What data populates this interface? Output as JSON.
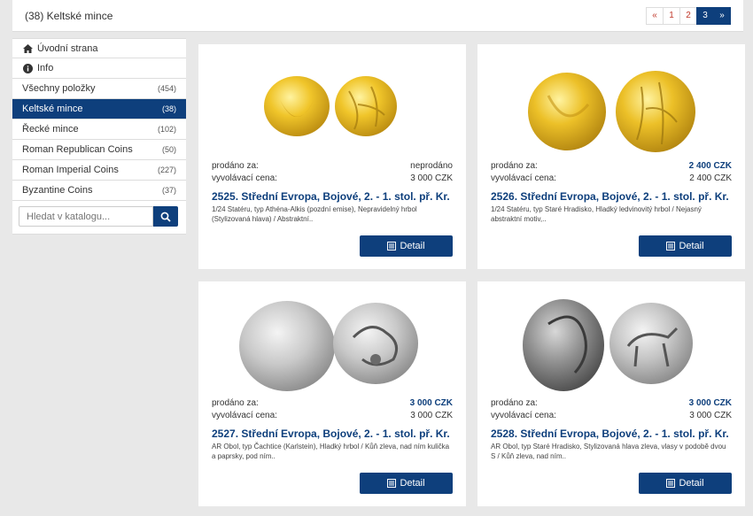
{
  "header": {
    "title": "(38) Keltské mince"
  },
  "pagination": {
    "prev": "«",
    "pages": [
      "1",
      "2",
      "3"
    ],
    "active": "3",
    "next": "»"
  },
  "sidebar": {
    "home": "Úvodní strana",
    "info": "Info",
    "items": [
      {
        "label": "Všechny položky",
        "count": "(454)"
      },
      {
        "label": "Keltské mince",
        "count": "(38)"
      },
      {
        "label": "Řecké mince",
        "count": "(102)"
      },
      {
        "label": "Roman Republican Coins",
        "count": "(50)"
      },
      {
        "label": "Roman Imperial Coins",
        "count": "(227)"
      },
      {
        "label": "Byzantine Coins",
        "count": "(37)"
      }
    ],
    "search_placeholder": "Hledat v katalogu..."
  },
  "labels": {
    "sold_for": "prodáno za:",
    "starting_price": "vyvolávací cena:",
    "detail": "Detail"
  },
  "lots": [
    {
      "sold": "neprodáno",
      "start": "3 000 CZK",
      "title": "2525. Střední Evropa, Bojové, 2. - 1. stol. př. Kr.",
      "desc": "1/24 Statéru, typ Athéna-Alkis (pozdní emise), Nepravidelný hrbol (Stylizovaná hlava) / Abstraktní..",
      "metal": "gold"
    },
    {
      "sold": "2 400 CZK",
      "start": "2 400 CZK",
      "title": "2526. Střední Evropa, Bojové, 2. - 1. stol. př. Kr.",
      "desc": "1/24 Statéru, typ Staré Hradisko, Hladký ledvinovitý hrbol / Nejasný abstraktní motiv,..",
      "metal": "gold"
    },
    {
      "sold": "3 000 CZK",
      "start": "3 000 CZK",
      "title": "2527. Střední Evropa, Bojové, 2. - 1. stol. př. Kr.",
      "desc": "AR Obol, typ Čachtice (Karlstein), Hladký hrbol / Kůň zleva, nad ním kulička a paprsky, pod ním..",
      "metal": "silver"
    },
    {
      "sold": "3 000 CZK",
      "start": "3 000 CZK",
      "title": "2528. Střední Evropa, Bojové, 2. - 1. stol. př. Kr.",
      "desc": "AR Obol, typ Staré Hradisko, Stylizovaná hlava zleva, vlasy v podobě dvou S / Kůň zleva, nad ním..",
      "metal": "silver"
    }
  ]
}
